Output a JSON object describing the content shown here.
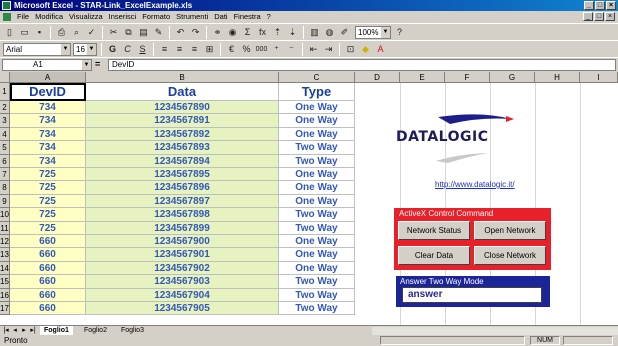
{
  "window": {
    "title": "Microsoft Excel - STAR-Link_ExcelExample.xls",
    "controls": [
      "_",
      "□",
      "×"
    ]
  },
  "menubar": {
    "items": [
      "File",
      "Modifica",
      "Visualizza",
      "Inserisci",
      "Formato",
      "Strumenti",
      "Dati",
      "Finestra",
      "?"
    ],
    "doc_controls": [
      "_",
      "□",
      "×"
    ]
  },
  "toolbar": {
    "zoom": "100%",
    "font": "Arial",
    "font_size": "16",
    "bold": "G",
    "italic": "C",
    "underline": "S",
    "currency": "€",
    "percent": "%",
    "thousands": "000",
    "sum_icon": "Σ",
    "function_icon": "fx"
  },
  "formula_bar": {
    "name_box": "A1",
    "equals": "=",
    "content": "DevID"
  },
  "columns": [
    "A",
    "B",
    "C",
    "D",
    "E",
    "F",
    "G",
    "H",
    "I"
  ],
  "rows": [
    "1",
    "2",
    "3",
    "4",
    "5",
    "6",
    "7",
    "8",
    "9",
    "10",
    "11",
    "12",
    "13",
    "14",
    "15",
    "16",
    "17"
  ],
  "table": {
    "headers": [
      "DevID",
      "Data",
      "Type"
    ],
    "rows": [
      [
        "734",
        "1234567890",
        "One Way"
      ],
      [
        "734",
        "1234567891",
        "One Way"
      ],
      [
        "734",
        "1234567892",
        "One Way"
      ],
      [
        "734",
        "1234567893",
        "Two Way"
      ],
      [
        "734",
        "1234567894",
        "Two Way"
      ],
      [
        "725",
        "1234567895",
        "One Way"
      ],
      [
        "725",
        "1234567896",
        "One Way"
      ],
      [
        "725",
        "1234567897",
        "One Way"
      ],
      [
        "725",
        "1234567898",
        "Two Way"
      ],
      [
        "725",
        "1234567899",
        "Two Way"
      ],
      [
        "660",
        "1234567900",
        "One Way"
      ],
      [
        "660",
        "1234567901",
        "One Way"
      ],
      [
        "660",
        "1234567902",
        "One Way"
      ],
      [
        "660",
        "1234567903",
        "Two Way"
      ],
      [
        "660",
        "1234567904",
        "Two Way"
      ],
      [
        "660",
        "1234567905",
        "Two Way"
      ]
    ]
  },
  "panel": {
    "logo": "DATALOGIC",
    "link": "http://www.datalogic.it/",
    "activex_title": "ActiveX Control Command",
    "buttons": {
      "network_status": "Network Status",
      "open_network": "Open Network",
      "clear_data": "Clear Data",
      "close_network": "Close Network"
    },
    "answer_title": "Answer Two Way Mode",
    "answer_value": "answer"
  },
  "sheets": {
    "tabs": [
      "Foglio1",
      "Foglio2",
      "Foglio3"
    ],
    "active": "Foglio1"
  },
  "status": {
    "left": "Pronto",
    "num": "NUM"
  },
  "colors": {
    "title_bar": "#00007b",
    "header_text": "#1b3f9e",
    "col_a_fill": "#ffffc4",
    "col_b_fill": "#e6f2bf",
    "activex_red": "#e8202a",
    "answer_blue": "#1c249a"
  }
}
